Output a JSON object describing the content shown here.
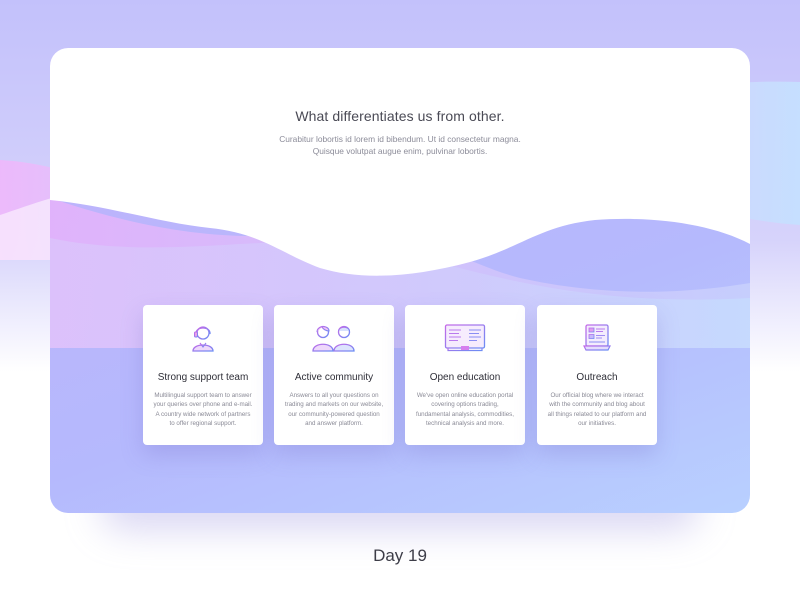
{
  "colors": {
    "accent_purple": "#b86cf0",
    "accent_blue": "#6a8cf5",
    "panel_gradient_start": "#c0b1fb",
    "panel_gradient_end": "#b8d0ff",
    "wave_pink": "#e7b6fb"
  },
  "hero": {
    "title": "What differentiates us from other.",
    "subtitle": "Curabitur lobortis id lorem id bibendum. Ut id consectetur magna. Quisque volutpat augue enim, pulvinar lobortis."
  },
  "features": [
    {
      "icon": "support-agent-icon",
      "title": "Strong support team",
      "description": "Multilingual support team to answer your queries over phone and e-mail. A country wide network of partners to offer regional support."
    },
    {
      "icon": "community-people-icon",
      "title": "Active community",
      "description": "Answers to all your questions on trading and markets on our website, our community-powered question and answer platform."
    },
    {
      "icon": "open-book-icon",
      "title": "Open education",
      "description": "We've open online education portal covering options trading, fundamental analysis, commodities, technical analysis and more."
    },
    {
      "icon": "blog-monitor-icon",
      "title": "Outreach",
      "description": "Our official blog where we interact with the community and blog about all things related to our platform and our initiatives."
    }
  ],
  "footer": {
    "day_label": "Day 19"
  }
}
